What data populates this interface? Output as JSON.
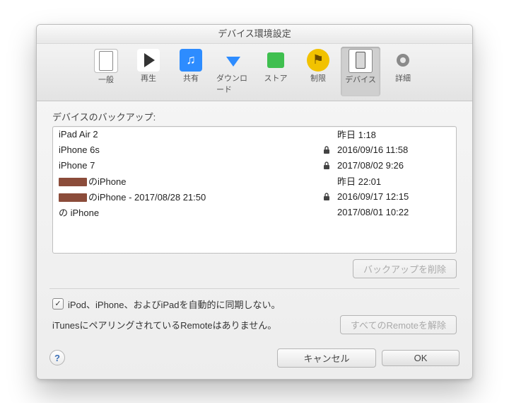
{
  "window": {
    "title": "デバイス環境設定"
  },
  "toolbar": {
    "items": [
      {
        "id": "general",
        "label": "一般"
      },
      {
        "id": "playback",
        "label": "再生"
      },
      {
        "id": "sharing",
        "label": "共有"
      },
      {
        "id": "downloads",
        "label": "ダウンロード"
      },
      {
        "id": "store",
        "label": "ストア"
      },
      {
        "id": "restrict",
        "label": "制限"
      },
      {
        "id": "devices",
        "label": "デバイス",
        "active": true
      },
      {
        "id": "advanced",
        "label": "詳細"
      }
    ]
  },
  "backups": {
    "section_label": "デバイスのバックアップ:",
    "rows": [
      {
        "name": "iPad Air 2",
        "locked": false,
        "date": "昨日 1:18"
      },
      {
        "name": "iPhone 6s",
        "locked": true,
        "date": "2016/09/16 11:58"
      },
      {
        "name": "iPhone 7",
        "locked": true,
        "date": "2017/08/02 9:26"
      },
      {
        "name": "のiPhone",
        "locked": false,
        "date": "昨日 22:01",
        "redacted": true
      },
      {
        "name": "のiPhone - 2017/08/28 21:50",
        "locked": true,
        "date": "2016/09/17 12:15",
        "redacted": true
      },
      {
        "name": "の iPhone",
        "locked": false,
        "date": "2017/08/01 10:22"
      }
    ],
    "delete_button": "バックアップを削除"
  },
  "sync": {
    "checkbox_label": "iPod、iPhone、およびiPadを自動的に同期しない。",
    "checked": true,
    "remote_text": "iTunesにペアリングされているRemoteはありません。",
    "remote_button": "すべてのRemoteを解除"
  },
  "footer": {
    "cancel": "キャンセル",
    "ok": "OK"
  }
}
